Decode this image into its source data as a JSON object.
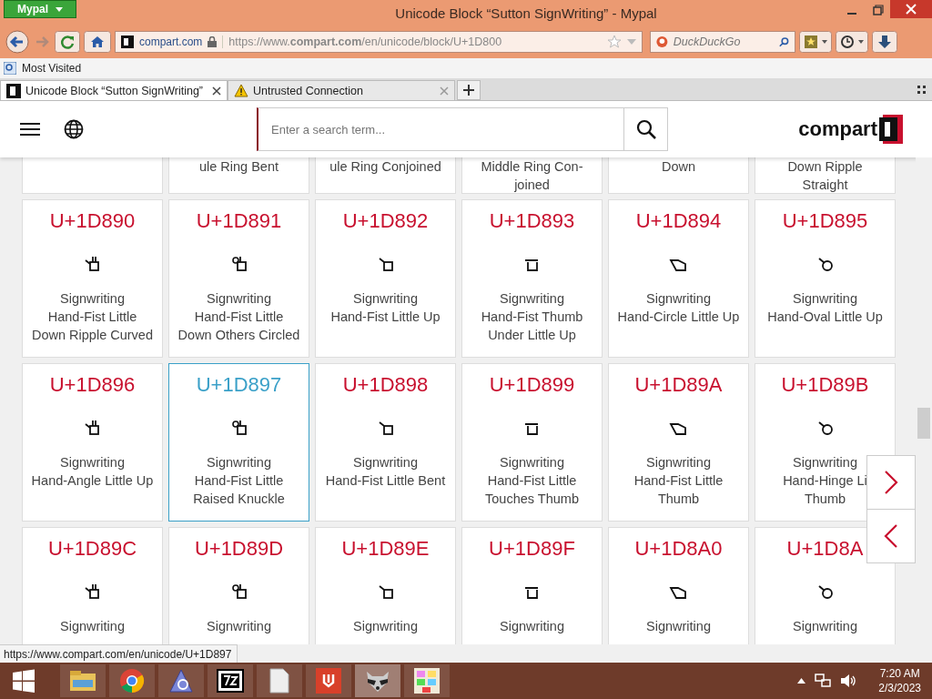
{
  "window": {
    "app_menu": "Mypal",
    "title": "Unicode Block “Sutton SignWriting” - Mypal"
  },
  "toolbar": {
    "site": "compart.com",
    "url": "https://www.**compart.com**/en/unicode/block/U+1D800",
    "search_placeholder": "DuckDuckGo"
  },
  "bookmarks": [
    "Most Visited"
  ],
  "tabs": [
    {
      "label": "Unicode Block “Sutton SignWriting”",
      "selected": true
    },
    {
      "label": "Untrusted Connection",
      "selected": false
    }
  ],
  "site_header": {
    "search_placeholder": "Enter a search term...",
    "logo": "compart"
  },
  "partial_row": [
    [
      "ule Ring Bent"
    ],
    [
      "ule Ring Conjoined"
    ],
    [
      "Middle Ring Con-",
      "joined"
    ],
    [
      "Down"
    ],
    [
      "Down Ripple",
      "Straight"
    ]
  ],
  "cards": [
    {
      "code": "U+1D890",
      "lines": [
        "Signwriting",
        "Hand-Fist Little",
        "Down Ripple Curved"
      ],
      "selected": false
    },
    {
      "code": "U+1D891",
      "lines": [
        "Signwriting",
        "Hand-Fist Little",
        "Down Others Circled"
      ],
      "selected": false
    },
    {
      "code": "U+1D892",
      "lines": [
        "Signwriting",
        "Hand-Fist Little Up"
      ],
      "selected": false
    },
    {
      "code": "U+1D893",
      "lines": [
        "Signwriting",
        "Hand-Fist Thumb",
        "Under Little Up"
      ],
      "selected": false
    },
    {
      "code": "U+1D894",
      "lines": [
        "Signwriting",
        "Hand-Circle Little Up"
      ],
      "selected": false
    },
    {
      "code": "U+1D895",
      "lines": [
        "Signwriting",
        "Hand-Oval Little Up"
      ],
      "selected": false
    },
    {
      "code": "U+1D896",
      "lines": [
        "Signwriting",
        "Hand-Angle Little Up"
      ],
      "selected": false
    },
    {
      "code": "U+1D897",
      "lines": [
        "Signwriting",
        "Hand-Fist Little",
        "Raised Knuckle"
      ],
      "selected": true
    },
    {
      "code": "U+1D898",
      "lines": [
        "Signwriting",
        "Hand-Fist Little Bent"
      ],
      "selected": false
    },
    {
      "code": "U+1D899",
      "lines": [
        "Signwriting",
        "Hand-Fist Little",
        "Touches Thumb"
      ],
      "selected": false
    },
    {
      "code": "U+1D89A",
      "lines": [
        "Signwriting",
        "Hand-Fist Little",
        "Thumb"
      ],
      "selected": false
    },
    {
      "code": "U+1D89B",
      "lines": [
        "Signwriting",
        "Hand-Hinge Li",
        "Thumb"
      ],
      "selected": false
    },
    {
      "code": "U+1D89C",
      "lines": [
        "Signwriting"
      ],
      "selected": false
    },
    {
      "code": "U+1D89D",
      "lines": [
        "Signwriting"
      ],
      "selected": false
    },
    {
      "code": "U+1D89E",
      "lines": [
        "Signwriting"
      ],
      "selected": false
    },
    {
      "code": "U+1D89F",
      "lines": [
        "Signwriting"
      ],
      "selected": false
    },
    {
      "code": "U+1D8A0",
      "lines": [
        "Signwriting"
      ],
      "selected": false
    },
    {
      "code": "U+1D8A",
      "lines": [
        "Signwriting"
      ],
      "selected": false
    }
  ],
  "status_url": "https://www.compart.com/en/unicode/U+1D897",
  "clock": {
    "time": "7:20 AM",
    "date": "2/3/2023"
  }
}
